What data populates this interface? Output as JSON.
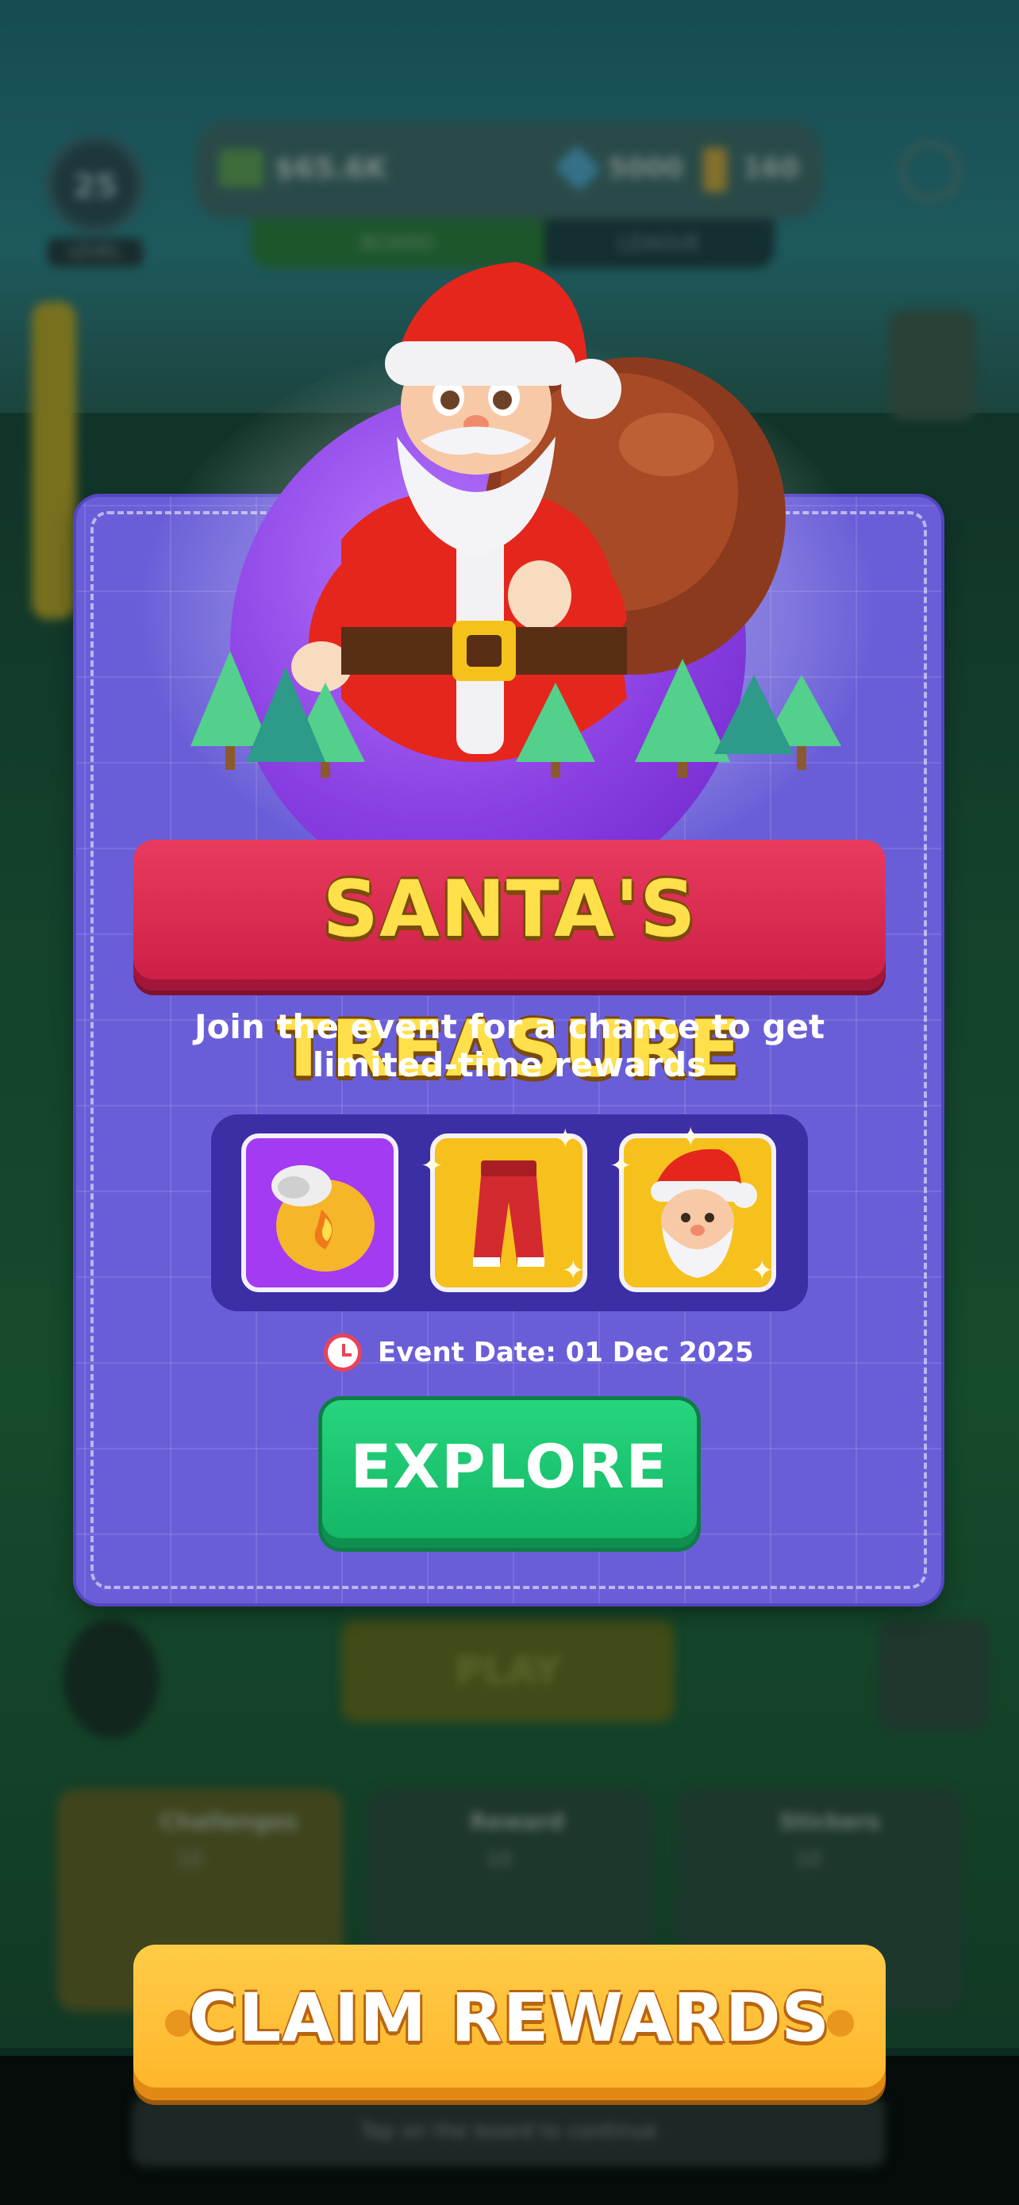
{
  "background": {
    "level": "25",
    "level_label": "LEVEL",
    "cash": "$65.6K",
    "gems": "5000",
    "tickets": "160",
    "tab_1": "BOARD",
    "tab_2": "LEAGUE",
    "play_label": "PLAY",
    "cards": [
      {
        "title": "Challenges",
        "sub": "10"
      },
      {
        "title": "Reward",
        "sub": "10"
      },
      {
        "title": "Stickers",
        "sub": "10"
      }
    ],
    "footer": "Tap on the board to continue"
  },
  "event": {
    "title": "SANTA'S TREASURE",
    "subtitle_line1": "Join the event for a chance to get",
    "subtitle_line2": "limited-time rewards",
    "rewards": [
      {
        "icon": "boxing-glove-icon",
        "rarity": "epic",
        "color": "#a33bf2"
      },
      {
        "icon": "red-pants-icon",
        "rarity": "legendary",
        "color": "#f6c11c"
      },
      {
        "icon": "santa-head-icon",
        "rarity": "legendary",
        "color": "#f6c11c"
      }
    ],
    "event_date_label": "Event Date: 01 Dec 2025",
    "explore_label": "EXPLORE"
  },
  "claim_rewards_label": "CLAIM REWARDS",
  "colors": {
    "popup": "#6a5ed8",
    "title_banner": "#cc1e45",
    "title_text": "#ffdf4a",
    "explore": "#13b565",
    "claim": "#ffb52a"
  }
}
